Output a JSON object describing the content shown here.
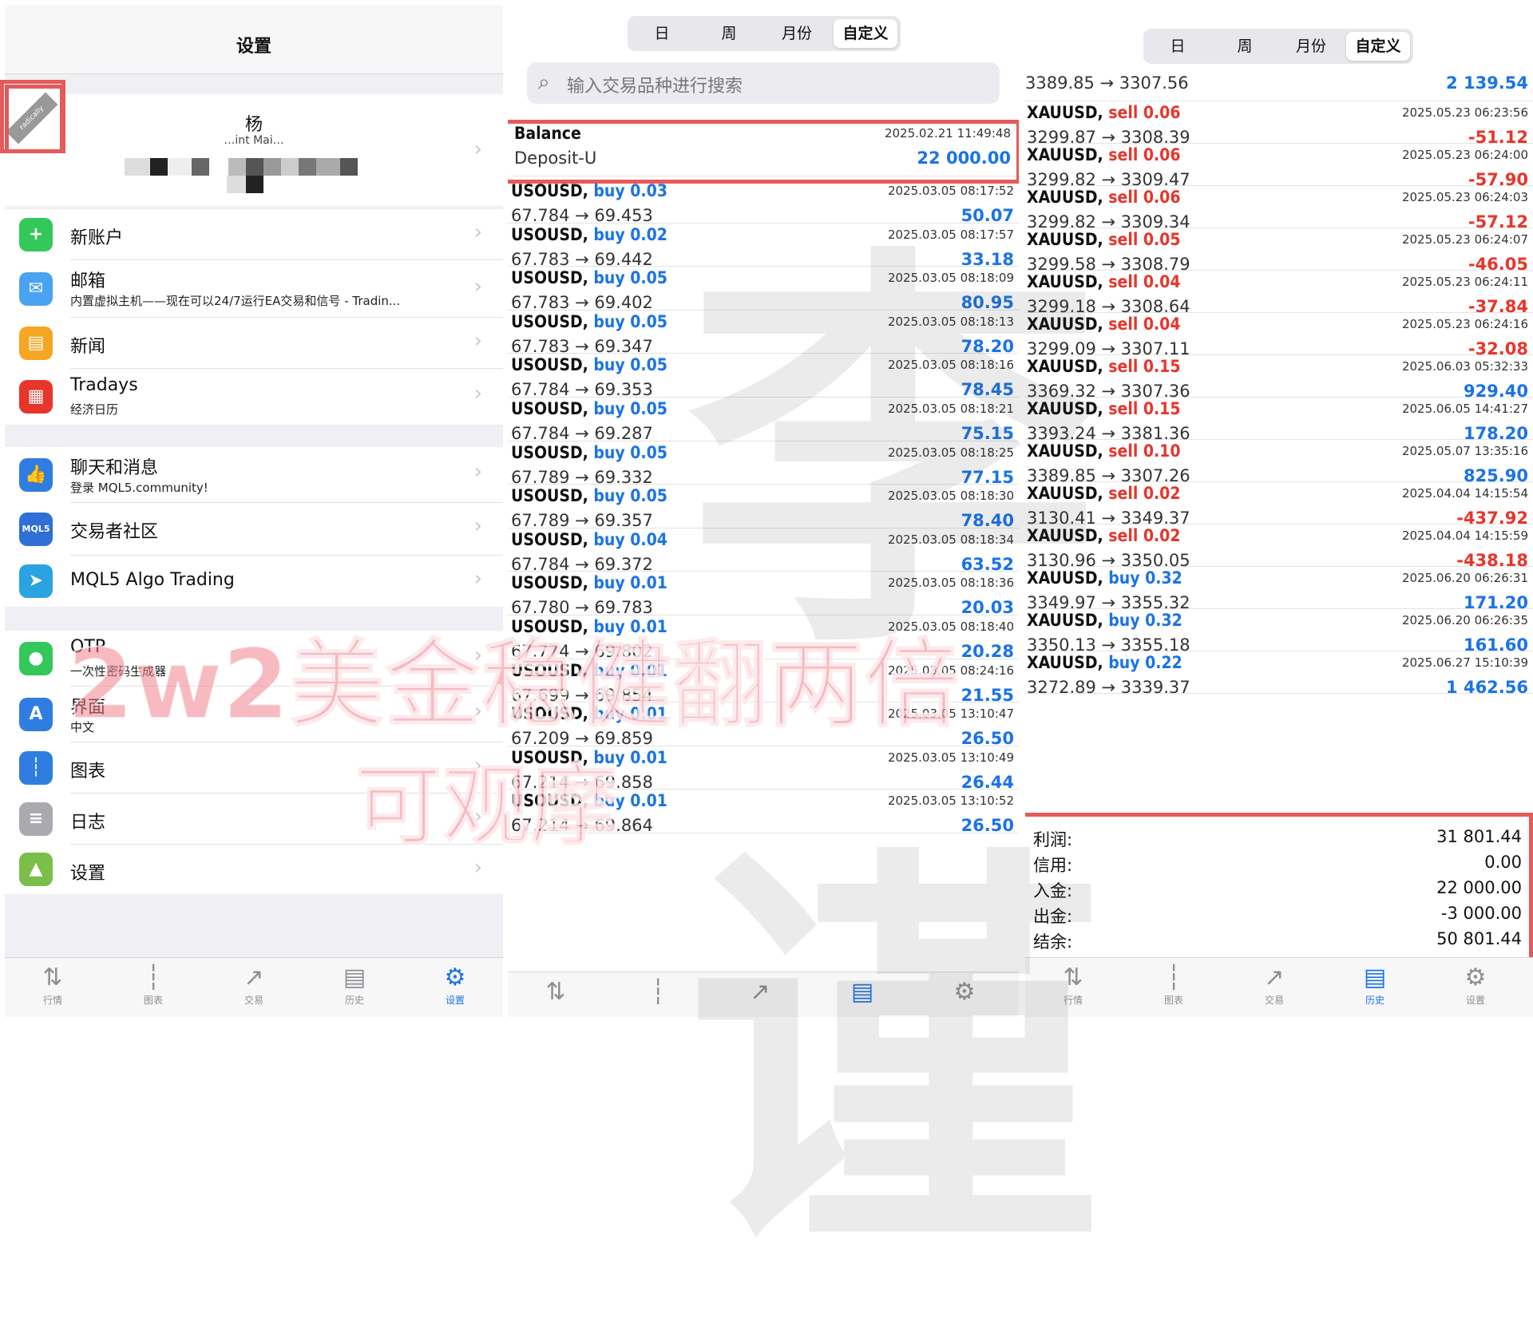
{
  "settings_panel": {
    "title": "设置",
    "profile": {
      "name": "杨",
      "account_partial": "…int Mai…",
      "tag_text": "radically"
    },
    "group1": [
      {
        "icon": "new-account-icon",
        "color": "#34c759",
        "label": "新账户",
        "sub": ""
      },
      {
        "icon": "mail-icon",
        "color": "#4aa3f0",
        "label": "邮箱",
        "sub": "内置虚拟主机——现在可以24/7运行EA交易和信号 - Tradin..."
      },
      {
        "icon": "news-icon",
        "color": "#f5a623",
        "label": "新闻",
        "sub": ""
      },
      {
        "icon": "tradays-icon",
        "color": "#e8352a",
        "label": "Tradays",
        "sub": "经济日历"
      }
    ],
    "group2": [
      {
        "icon": "chat-icon",
        "color": "#2f7de1",
        "label": "聊天和消息",
        "sub": "登录 MQL5.community!"
      },
      {
        "icon": "mql5-icon",
        "color": "#2f6fd6",
        "label": "交易者社区",
        "sub": "",
        "badge": "MQL5"
      },
      {
        "icon": "telegram-icon",
        "color": "#2aa3e0",
        "label": "MQL5 Algo Trading",
        "sub": ""
      }
    ],
    "group3": [
      {
        "icon": "otp-icon",
        "color": "#34c759",
        "label": "OTP",
        "sub": "一次性密码生成器"
      },
      {
        "icon": "language-icon",
        "color": "#2f7de1",
        "label": "界面",
        "sub": "中文"
      },
      {
        "icon": "chart-icon",
        "color": "#2f7de1",
        "label": "图表",
        "sub": ""
      },
      {
        "icon": "journal-icon",
        "color": "#a9a9b0",
        "label": "日志",
        "sub": ""
      },
      {
        "icon": "settings-app-icon",
        "color": "#7bbf4a",
        "label": "设置",
        "sub": ""
      }
    ],
    "tabs": [
      {
        "label": "行情",
        "glyph": "⇅",
        "active": false
      },
      {
        "label": "图表",
        "glyph": "┆",
        "active": false
      },
      {
        "label": "交易",
        "glyph": "↗",
        "active": false
      },
      {
        "label": "历史",
        "glyph": "▤",
        "active": false
      },
      {
        "label": "设置",
        "glyph": "⚙",
        "active": true
      }
    ]
  },
  "overlay": {
    "headline": "2w2美金稳健翻两倍",
    "subline": "可观摩"
  },
  "history_panel_1": {
    "segments": [
      "日",
      "周",
      "月份",
      "自定义"
    ],
    "active_segment": "自定义",
    "search_placeholder": "输入交易品种进行搜索",
    "balance": {
      "title": "Balance",
      "sub": "Deposit-U",
      "time": "2025.02.21 11:49:48",
      "amount": "22 000.00"
    },
    "deals": [
      {
        "sym": "USOUSD",
        "side": "buy",
        "vol": "0.03",
        "prices": "67.784 → 69.453",
        "time": "2025.03.05 08:17:52",
        "profit": "50.07"
      },
      {
        "sym": "USOUSD",
        "side": "buy",
        "vol": "0.02",
        "prices": "67.783 → 69.442",
        "time": "2025.03.05 08:17:57",
        "profit": "33.18"
      },
      {
        "sym": "USOUSD",
        "side": "buy",
        "vol": "0.05",
        "prices": "67.783 → 69.402",
        "time": "2025.03.05 08:18:09",
        "profit": "80.95"
      },
      {
        "sym": "USOUSD",
        "side": "buy",
        "vol": "0.05",
        "prices": "67.783 → 69.347",
        "time": "2025.03.05 08:18:13",
        "profit": "78.20"
      },
      {
        "sym": "USOUSD",
        "side": "buy",
        "vol": "0.05",
        "prices": "67.784 → 69.353",
        "time": "2025.03.05 08:18:16",
        "profit": "78.45"
      },
      {
        "sym": "USOUSD",
        "side": "buy",
        "vol": "0.05",
        "prices": "67.784 → 69.287",
        "time": "2025.03.05 08:18:21",
        "profit": "75.15"
      },
      {
        "sym": "USOUSD",
        "side": "buy",
        "vol": "0.05",
        "prices": "67.789 → 69.332",
        "time": "2025.03.05 08:18:25",
        "profit": "77.15"
      },
      {
        "sym": "USOUSD",
        "side": "buy",
        "vol": "0.05",
        "prices": "67.789 → 69.357",
        "time": "2025.03.05 08:18:30",
        "profit": "78.40"
      },
      {
        "sym": "USOUSD",
        "side": "buy",
        "vol": "0.04",
        "prices": "67.784 → 69.372",
        "time": "2025.03.05 08:18:34",
        "profit": "63.52"
      },
      {
        "sym": "USOUSD",
        "side": "buy",
        "vol": "0.01",
        "prices": "67.780 → 69.783",
        "time": "2025.03.05 08:18:36",
        "profit": "20.03"
      },
      {
        "sym": "USOUSD",
        "side": "buy",
        "vol": "0.01",
        "prices": "67.774 → 69.802",
        "time": "2025.03.05 08:18:40",
        "profit": "20.28"
      },
      {
        "sym": "USOUSD",
        "side": "buy",
        "vol": "0.01",
        "prices": "67.699 → 69.854",
        "time": "2025.03.05 08:24:16",
        "profit": "21.55"
      },
      {
        "sym": "USOUSD",
        "side": "buy",
        "vol": "0.01",
        "prices": "67.209 → 69.859",
        "time": "2025.03.05 13:10:47",
        "profit": "26.50"
      },
      {
        "sym": "USOUSD",
        "side": "buy",
        "vol": "0.01",
        "prices": "67.214 → 69.858",
        "time": "2025.03.05 13:10:49",
        "profit": "26.44"
      },
      {
        "sym": "USOUSD",
        "side": "buy",
        "vol": "0.01",
        "prices": "67.214 → 69.864",
        "time": "2025.03.05 13:10:52",
        "profit": "26.50"
      }
    ],
    "tabs": [
      {
        "label": "",
        "glyph": "⇅",
        "active": false
      },
      {
        "label": "",
        "glyph": "┆",
        "active": false
      },
      {
        "label": "",
        "glyph": "↗",
        "active": false
      },
      {
        "label": "",
        "glyph": "▤",
        "active": true
      },
      {
        "label": "",
        "glyph": "⚙",
        "active": false
      }
    ]
  },
  "history_panel_2": {
    "segments": [
      "日",
      "周",
      "月份",
      "自定义"
    ],
    "active_segment": "自定义",
    "top_partial": {
      "prices": "3389.85 → 3307.56",
      "profit": "2 139.54"
    },
    "deals": [
      {
        "sym": "XAUUSD",
        "side": "sell",
        "vol": "0.06",
        "prices": "3299.87 → 3308.39",
        "time": "2025.05.23 06:23:56",
        "profit": "-51.12"
      },
      {
        "sym": "XAUUSD",
        "side": "sell",
        "vol": "0.06",
        "prices": "3299.82 → 3309.47",
        "time": "2025.05.23 06:24:00",
        "profit": "-57.90"
      },
      {
        "sym": "XAUUSD",
        "side": "sell",
        "vol": "0.06",
        "prices": "3299.82 → 3309.34",
        "time": "2025.05.23 06:24:03",
        "profit": "-57.12"
      },
      {
        "sym": "XAUUSD",
        "side": "sell",
        "vol": "0.05",
        "prices": "3299.58 → 3308.79",
        "time": "2025.05.23 06:24:07",
        "profit": "-46.05"
      },
      {
        "sym": "XAUUSD",
        "side": "sell",
        "vol": "0.04",
        "prices": "3299.18 → 3308.64",
        "time": "2025.05.23 06:24:11",
        "profit": "-37.84"
      },
      {
        "sym": "XAUUSD",
        "side": "sell",
        "vol": "0.04",
        "prices": "3299.09 → 3307.11",
        "time": "2025.05.23 06:24:16",
        "profit": "-32.08"
      },
      {
        "sym": "XAUUSD",
        "side": "sell",
        "vol": "0.15",
        "prices": "3369.32 → 3307.36",
        "time": "2025.06.03 05:32:33",
        "profit": "929.40"
      },
      {
        "sym": "XAUUSD",
        "side": "sell",
        "vol": "0.15",
        "prices": "3393.24 → 3381.36",
        "time": "2025.06.05 14:41:27",
        "profit": "178.20"
      },
      {
        "sym": "XAUUSD",
        "side": "sell",
        "vol": "0.10",
        "prices": "3389.85 → 3307.26",
        "time": "2025.05.07 13:35:16",
        "profit": "825.90"
      },
      {
        "sym": "XAUUSD",
        "side": "sell",
        "vol": "0.02",
        "prices": "3130.41 → 3349.37",
        "time": "2025.04.04 14:15:54",
        "profit": "-437.92"
      },
      {
        "sym": "XAUUSD",
        "side": "sell",
        "vol": "0.02",
        "prices": "3130.96 → 3350.05",
        "time": "2025.04.04 14:15:59",
        "profit": "-438.18"
      },
      {
        "sym": "XAUUSD",
        "side": "buy",
        "vol": "0.32",
        "prices": "3349.97 → 3355.32",
        "time": "2025.06.20 06:26:31",
        "profit": "171.20"
      },
      {
        "sym": "XAUUSD",
        "side": "buy",
        "vol": "0.32",
        "prices": "3350.13 → 3355.18",
        "time": "2025.06.20 06:26:35",
        "profit": "161.60"
      },
      {
        "sym": "XAUUSD",
        "side": "buy",
        "vol": "0.22",
        "prices": "3272.89 → 3339.37",
        "time": "2025.06.27 15:10:39",
        "profit": "1 462.56"
      }
    ],
    "summary": [
      {
        "key": "利润:",
        "value": "31 801.44"
      },
      {
        "key": "信用:",
        "value": "0.00"
      },
      {
        "key": "入金:",
        "value": "22 000.00"
      },
      {
        "key": "出金:",
        "value": "-3 000.00"
      },
      {
        "key": "结余:",
        "value": "50 801.44"
      }
    ],
    "tabs": [
      {
        "label": "行情",
        "glyph": "⇅",
        "active": false
      },
      {
        "label": "图表",
        "glyph": "┆",
        "active": false
      },
      {
        "label": "交易",
        "glyph": "↗",
        "active": false
      },
      {
        "label": "历史",
        "glyph": "▤",
        "active": true
      },
      {
        "label": "设置",
        "glyph": "⚙",
        "active": false
      }
    ]
  },
  "watermark": {
    "chars": "李 谨"
  },
  "colors": {
    "accent": "#1a73e8",
    "loss": "#e8352a",
    "highlight_box": "#e65a5a"
  }
}
